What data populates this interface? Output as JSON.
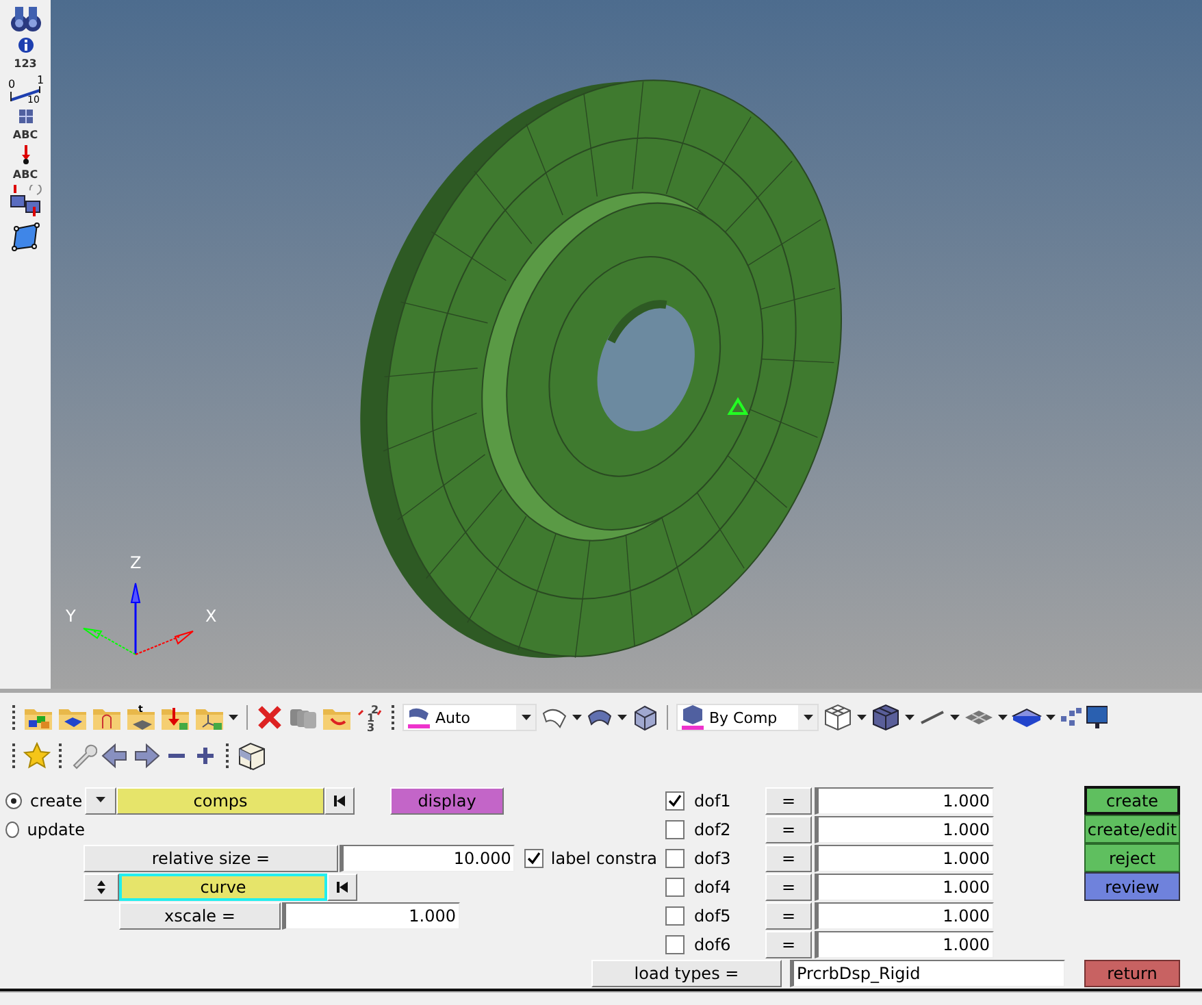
{
  "side_toolbar": {
    "info_caption": "123",
    "ruler_labels": [
      "0",
      "1",
      "10"
    ],
    "label_captions": [
      "ABC",
      "ABC"
    ]
  },
  "viewport": {
    "axes": {
      "z": "Z",
      "y": "Y",
      "x": "X"
    }
  },
  "toolbar": {
    "thickness_mark": "t",
    "renumber_digits": [
      "2",
      "1",
      "3"
    ],
    "render_mode": "Auto",
    "color_mode": "By Comp"
  },
  "panel": {
    "mode_radios": [
      {
        "label": "create",
        "selected": true
      },
      {
        "label": "update",
        "selected": false
      }
    ],
    "entity_selector": "comps",
    "display_button": "display",
    "relative_size": {
      "label": "relative size =",
      "value": "10.000"
    },
    "label_checkbox": {
      "label": "label constra",
      "checked": true
    },
    "curve_selector": "curve",
    "xscale": {
      "label": "xscale  =",
      "value": "1.000"
    },
    "dofs": [
      {
        "label": "dof1",
        "checked": true,
        "operator": "=",
        "value": "1.000"
      },
      {
        "label": "dof2",
        "checked": false,
        "operator": "=",
        "value": "1.000"
      },
      {
        "label": "dof3",
        "checked": false,
        "operator": "=",
        "value": "1.000"
      },
      {
        "label": "dof4",
        "checked": false,
        "operator": "=",
        "value": "1.000"
      },
      {
        "label": "dof5",
        "checked": false,
        "operator": "=",
        "value": "1.000"
      },
      {
        "label": "dof6",
        "checked": false,
        "operator": "=",
        "value": "1.000"
      }
    ],
    "load_types": {
      "label": "load types =",
      "value": "PrcrbDsp_Rigid"
    },
    "actions": [
      {
        "label": "create",
        "kind": "default"
      },
      {
        "label": "create/edit",
        "kind": "normal"
      },
      {
        "label": "reject",
        "kind": "normal"
      },
      {
        "label": "review",
        "kind": "review"
      }
    ],
    "return_button": "return"
  }
}
